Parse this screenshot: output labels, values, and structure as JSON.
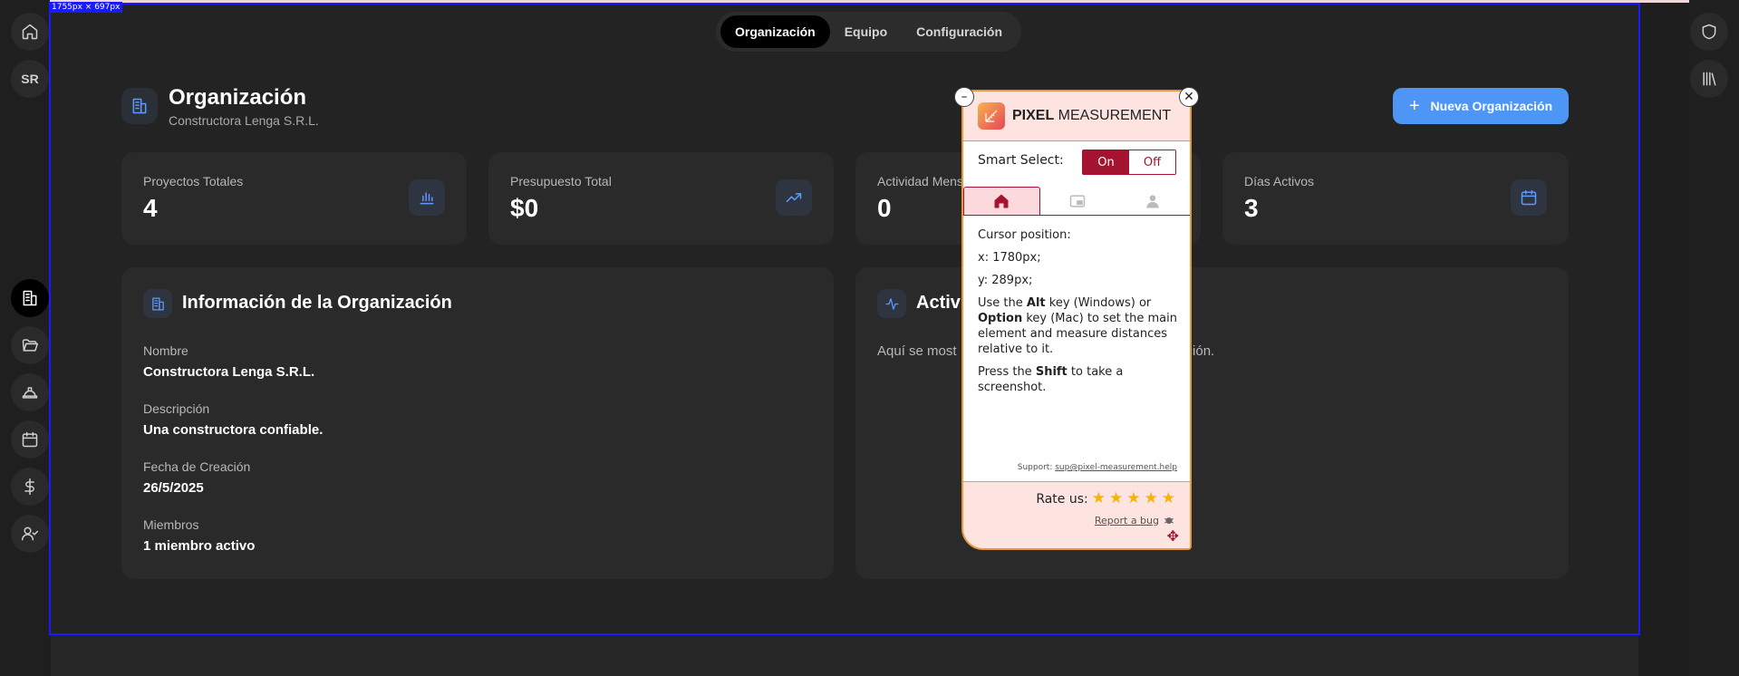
{
  "measure": {
    "label": "1755px × 697px"
  },
  "rail_left": {
    "avatar": "SR"
  },
  "tabs": [
    {
      "label": "Organización"
    },
    {
      "label": "Equipo"
    },
    {
      "label": "Configuración"
    }
  ],
  "header": {
    "title": "Organización",
    "subtitle": "Constructora Lenga S.R.L.",
    "new_button": "Nueva Organización"
  },
  "stats": [
    {
      "label": "Proyectos Totales",
      "value": "4",
      "icon": "bar-chart-icon"
    },
    {
      "label": "Presupuesto Total",
      "value": "$0",
      "icon": "trending-up-icon"
    },
    {
      "label": "Actividad Mens",
      "value": "0",
      "icon": "activity-icon"
    },
    {
      "label": "Días Activos",
      "value": "3",
      "icon": "calendar-icon"
    }
  ],
  "info": {
    "title": "Información de la Organización",
    "fields": [
      {
        "label": "Nombre",
        "value": "Constructora Lenga S.R.L."
      },
      {
        "label": "Descripción",
        "value": "Una constructora confiable."
      },
      {
        "label": "Fecha de Creación",
        "value": "26/5/2025"
      },
      {
        "label": "Miembros",
        "value": "1 miembro activo"
      }
    ]
  },
  "activity": {
    "title": "Activi",
    "text_left": "Aquí se most",
    "text_right": "nización."
  },
  "pixel_measurement": {
    "brand_bold": "PIXEL",
    "brand_rest": " MEASUREMENT",
    "smart_select": "Smart Select:",
    "on": "On",
    "off": "Off",
    "cursor_label": "Cursor position:",
    "x": "x: 1780px;",
    "y": "y: 289px;",
    "use_1": "Use the ",
    "alt": "Alt",
    "use_2": " key (Windows) or ",
    "option": "Option",
    "use_3": " key (Mac) to set the main element and measure distances relative to it.",
    "press_1": "Press the ",
    "shift": "Shift",
    "press_2": " to take a screenshot.",
    "support_label": "Support: ",
    "support_email": "sup@pixel-measurement.help",
    "rate": "Rate us:",
    "report": "Report a bug",
    "stars": 5
  }
}
